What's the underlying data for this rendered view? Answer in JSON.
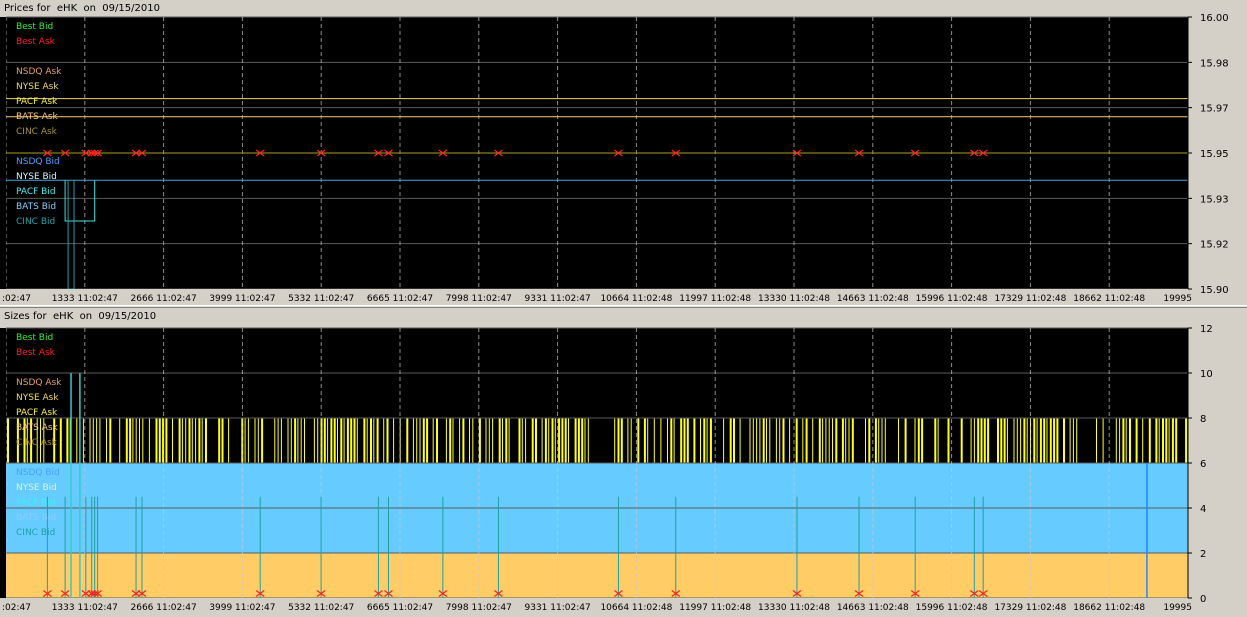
{
  "chart_data": [
    {
      "type": "line",
      "title": "Prices for  eHK  on  09/15/2010",
      "ylim": [
        15.9,
        16.0
      ],
      "y_ticks": [
        "16.00",
        "15.98",
        "15.97",
        "15.95",
        "15.93",
        "15.92",
        "15.90"
      ],
      "y_tick_values": [
        16.0,
        15.98333,
        15.96667,
        15.95,
        15.93333,
        15.91667,
        15.9
      ],
      "x_ticks": [
        ":02:47",
        "1333 11:02:47",
        "2666 11:02:47",
        "3999 11:02:47",
        "5332 11:02:47",
        "6665 11:02:47",
        "7998 11:02:47",
        "9331 11:02:47",
        "10664 11:02:48",
        "11997 11:02:48",
        "13330 11:02:48",
        "14663 11:02:48",
        "15996 11:02:48",
        "17329 11:02:48",
        "18662 11:02:48",
        "19995"
      ],
      "xlim": [
        0,
        19995
      ],
      "grid": true,
      "legend_position": "top-left",
      "legend": [
        {
          "label": "Best Bid",
          "color": "#33ee33"
        },
        {
          "label": "Best Ask",
          "color": "#ff2020"
        },
        {
          "label": "",
          "color": "#000000"
        },
        {
          "label": "NSDQ Ask",
          "color": "#e8a060"
        },
        {
          "label": "NYSE Ask",
          "color": "#f0d860"
        },
        {
          "label": "PACF Ask",
          "color": "#f8f040"
        },
        {
          "label": "BATS Ask",
          "color": "#f8c878"
        },
        {
          "label": "CINC Ask",
          "color": "#a89030"
        },
        {
          "label": "",
          "color": "#000000"
        },
        {
          "label": "NSDQ Bid",
          "color": "#4aa0ff"
        },
        {
          "label": "NYSE Bid",
          "color": "#d8f0ff"
        },
        {
          "label": "PACF Bid",
          "color": "#40f0f0"
        },
        {
          "label": "BATS Bid",
          "color": "#88ccff"
        },
        {
          "label": "CINC Bid",
          "color": "#20a0a8"
        }
      ],
      "series": [
        {
          "name": "NYSE Ask",
          "color": "#f0d860",
          "points": [
            [
              0,
              15.97
            ],
            [
              19995,
              15.97
            ]
          ]
        },
        {
          "name": "BATS Ask",
          "color": "#f8c878",
          "points": [
            [
              0,
              15.9633
            ],
            [
              19995,
              15.9633
            ]
          ]
        },
        {
          "name": "Best Ask",
          "color": "#a8a020",
          "points": [
            [
              0,
              15.95
            ],
            [
              19995,
              15.95
            ]
          ]
        },
        {
          "name": "NSDQ Bid",
          "color": "#40a8e0",
          "points": [
            [
              0,
              15.94
            ],
            [
              19995,
              15.94
            ]
          ]
        },
        {
          "name": "PACF Bid",
          "color": "#40e0e0",
          "points": [
            [
              1000,
              15.94
            ],
            [
              1000,
              15.925
            ],
            [
              1500,
              15.925
            ],
            [
              1500,
              15.94
            ]
          ]
        },
        {
          "name": "CINC Bid",
          "color": "#20a0a8",
          "points": [
            [
              1050,
              15.94
            ],
            [
              1050,
              15.9
            ],
            [
              1150,
              15.9
            ],
            [
              1150,
              15.94
            ]
          ]
        }
      ],
      "trade_markers": {
        "color": "#ff2020",
        "y": 15.95,
        "x": [
          700,
          1000,
          1350,
          1450,
          1500,
          1550,
          2200,
          2300,
          4300,
          5330,
          6300,
          6470,
          7390,
          8330,
          10360,
          11330,
          13380,
          14430,
          15380,
          16380,
          16530
        ]
      }
    },
    {
      "type": "area",
      "title": "Sizes for  eHK  on  09/15/2010",
      "ylim": [
        0,
        12
      ],
      "y_ticks": [
        "12",
        "10",
        "8",
        "6",
        "4",
        "2",
        "0"
      ],
      "y_tick_values": [
        12,
        10,
        8,
        6,
        4,
        2,
        0
      ],
      "x_ticks": [
        ":02:47",
        "1333 11:02:47",
        "2666 11:02:47",
        "3999 11:02:47",
        "5332 11:02:47",
        "6665 11:02:47",
        "7998 11:02:47",
        "9331 11:02:47",
        "10664 11:02:48",
        "11997 11:02:48",
        "13330 11:02:48",
        "14663 11:02:48",
        "15996 11:02:48",
        "17329 11:02:48",
        "18662 11:02:48",
        "19995"
      ],
      "xlim": [
        0,
        19995
      ],
      "grid": true,
      "legend_position": "top-left",
      "legend": [
        {
          "label": "Best Bid",
          "color": "#33ee33"
        },
        {
          "label": "Best Ask",
          "color": "#ff2020"
        },
        {
          "label": "",
          "color": "#000000"
        },
        {
          "label": "NSDQ Ask",
          "color": "#e8a060"
        },
        {
          "label": "NYSE Ask",
          "color": "#f0d860"
        },
        {
          "label": "PACF Ask",
          "color": "#f8f040"
        },
        {
          "label": "BATS Ask",
          "color": "#f8c878"
        },
        {
          "label": "CINC Ask",
          "color": "#a89030"
        },
        {
          "label": "",
          "color": "#000000"
        },
        {
          "label": "NSDQ Bid",
          "color": "#4aa0ff"
        },
        {
          "label": "NYSE Bid",
          "color": "#d8f0ff"
        },
        {
          "label": "PACF Bid",
          "color": "#40f0f0"
        },
        {
          "label": "BATS Bid",
          "color": "#88ccff"
        },
        {
          "label": "CINC Bid",
          "color": "#20a0a8"
        }
      ],
      "bands": [
        {
          "name": "Ask size band",
          "color": "#ffcc66",
          "from": 0,
          "to": 2
        },
        {
          "name": "Bid size band",
          "color": "#66ccff",
          "from": 2,
          "to": 6
        }
      ],
      "ask_size_stripes": {
        "color": "#ffff20",
        "from": 6,
        "to": 8,
        "gaps_x": [
          [
            9950,
            10150
          ],
          [
            14350,
            14500
          ],
          [
            14950,
            15050
          ]
        ]
      },
      "spikes": [
        {
          "x": 1100,
          "y": 10,
          "color": "#33cccc"
        },
        {
          "x": 1250,
          "y": 10,
          "color": "#33cccc"
        },
        {
          "x": 19300,
          "y": 6,
          "color": "#2288ff"
        }
      ],
      "trade_markers": {
        "color": "#ff2020",
        "y": 0.2,
        "stem_to": 4.5,
        "stem_color": "#20a0a0",
        "x": [
          700,
          1000,
          1350,
          1450,
          1500,
          1550,
          2200,
          2300,
          4300,
          5330,
          6300,
          6470,
          7390,
          8330,
          10360,
          11330,
          13380,
          14430,
          15380,
          16380,
          16530
        ]
      }
    }
  ]
}
